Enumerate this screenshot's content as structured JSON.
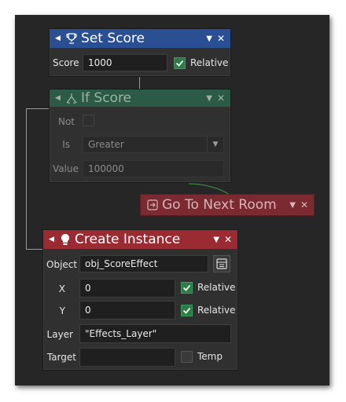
{
  "set_score": {
    "title": "Set Score",
    "score_label": "Score",
    "score_value": "1000",
    "relative_label": "Relative",
    "relative_checked": true,
    "header_color": "#2b4f93"
  },
  "if_score": {
    "title": "If Score",
    "not_label": "Not",
    "is_label": "Is",
    "is_value": "Greater",
    "value_label": "Value",
    "value_value": "100000",
    "header_color": "#2d5a47"
  },
  "go_to_next_room": {
    "title": "Go To Next Room",
    "header_color": "#7a2a30"
  },
  "create_instance": {
    "title": "Create Instance",
    "object_label": "Object",
    "object_value": "obj_ScoreEffect",
    "x_label": "X",
    "x_value": "0",
    "x_relative_label": "Relative",
    "x_relative_checked": true,
    "y_label": "Y",
    "y_value": "0",
    "y_relative_label": "Relative",
    "y_relative_checked": true,
    "layer_label": "Layer",
    "layer_value": "\"Effects_Layer\"",
    "target_label": "Target",
    "target_value": "",
    "temp_label": "Temp",
    "temp_checked": false,
    "header_color": "#9a2b33"
  },
  "icons": {
    "collapse": "triangle-collapse-icon",
    "dropdown": "chevron-down-icon",
    "close": "close-icon",
    "set_score": "trophy-icon",
    "if_score": "branch-icon",
    "go_to_next_room": "arrow-right-box-icon",
    "create_instance": "lightbulb-icon",
    "object_picker": "object-picker-icon"
  }
}
